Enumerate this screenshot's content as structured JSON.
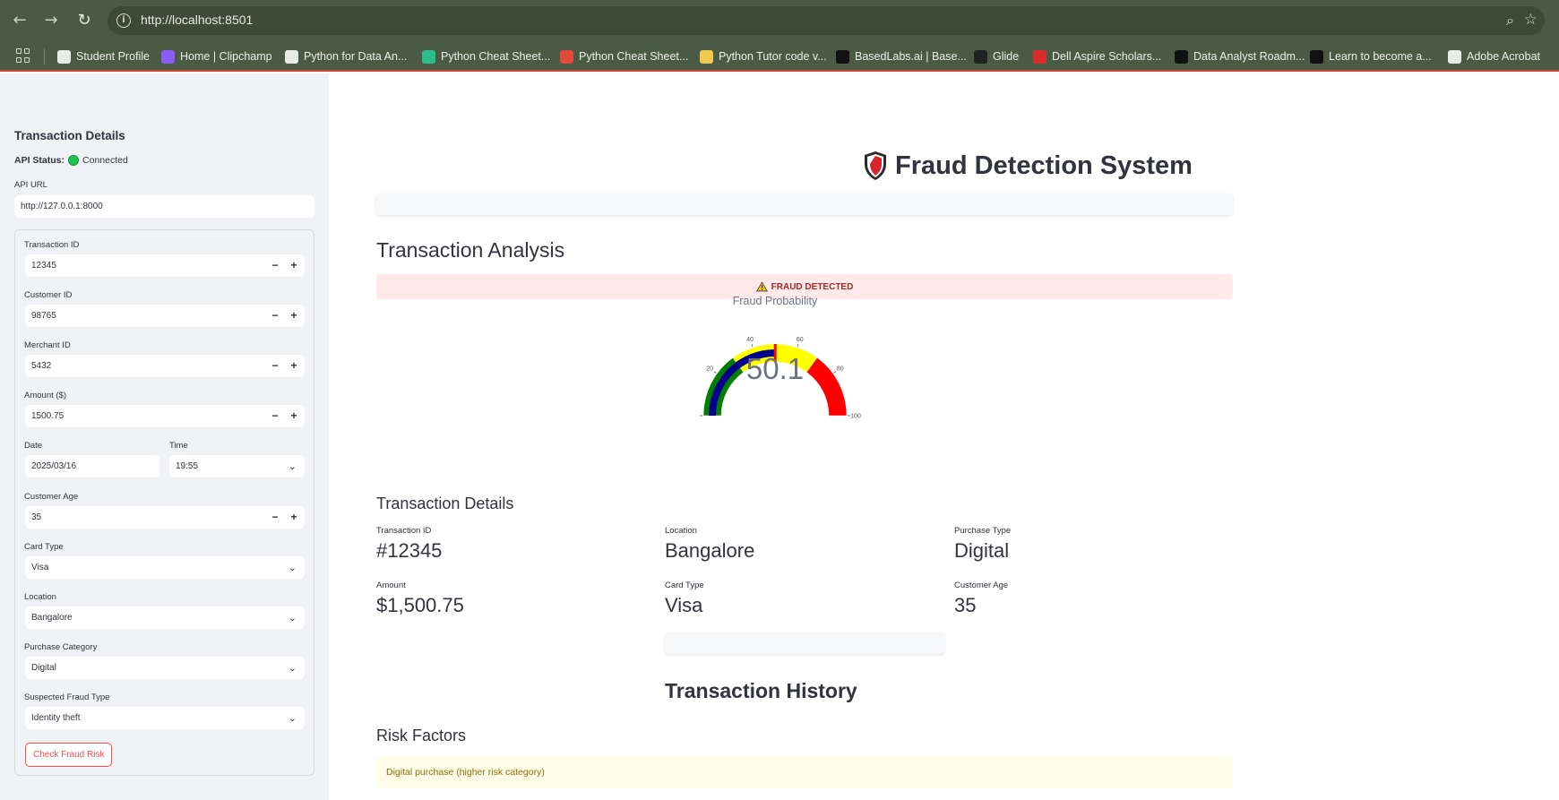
{
  "browser": {
    "url": "http://localhost:8501",
    "bookmarks": [
      {
        "label": "Student Profile",
        "color": "#e8ece5"
      },
      {
        "label": "Home | Clipchamp",
        "color": "#8a5cf5"
      },
      {
        "label": "Python for Data An...",
        "color": "#e8ece5"
      },
      {
        "label": "Python Cheat Sheet...",
        "color": "#2bbd8c"
      },
      {
        "label": "Python Cheat Sheet...",
        "color": "#e04a3a"
      },
      {
        "label": "Python Tutor code v...",
        "color": "#f2c94c"
      },
      {
        "label": "BasedLabs.ai | Base...",
        "color": "#111111"
      },
      {
        "label": "Glide",
        "color": "#222222"
      },
      {
        "label": "Dell Aspire Scholars...",
        "color": "#d92b2b"
      },
      {
        "label": "Data Analyst Roadm...",
        "color": "#111111"
      },
      {
        "label": "Learn to become a...",
        "color": "#111111"
      },
      {
        "label": "Adobe Acrobat",
        "color": "#e8ece5"
      }
    ]
  },
  "sidebar": {
    "title": "Transaction Details",
    "api_status_label": "API Status:",
    "api_status_value": "Connected",
    "api_url_label": "API URL",
    "api_url_value": "http://127.0.0.1:8000",
    "transaction_id_label": "Transaction ID",
    "transaction_id_value": "12345",
    "customer_id_label": "Customer ID",
    "customer_id_value": "98765",
    "merchant_id_label": "Merchant ID",
    "merchant_id_value": "5432",
    "amount_label": "Amount ($)",
    "amount_value": "1500.75",
    "date_label": "Date",
    "date_value": "2025/03/16",
    "time_label": "Time",
    "time_value": "19:55",
    "customer_age_label": "Customer Age",
    "customer_age_value": "35",
    "card_type_label": "Card Type",
    "card_type_value": "Visa",
    "location_label": "Location",
    "location_value": "Bangalore",
    "purchase_category_label": "Purchase Category",
    "purchase_category_value": "Digital",
    "fraud_type_label": "Suspected Fraud Type",
    "fraud_type_value": "Identity theft",
    "check_button": "Check Fraud Risk"
  },
  "main": {
    "title": "Fraud Detection System",
    "analysis_heading": "Transaction Analysis",
    "alert_text": "FRAUD DETECTED",
    "gauge": {
      "title": "Fraud Probability",
      "value": 50.1,
      "value_text": "50.1",
      "min": 0,
      "max": 100,
      "ticks": [
        "0",
        "20",
        "40",
        "60",
        "80",
        "100"
      ],
      "steps": [
        {
          "from": 0,
          "to": 30,
          "color": "#008000"
        },
        {
          "from": 30,
          "to": 70,
          "color": "#ffff00"
        },
        {
          "from": 70,
          "to": 100,
          "color": "#ff0000"
        }
      ],
      "bar_color": "#00008b",
      "threshold_color": "#ff0000"
    },
    "details_heading": "Transaction Details",
    "details": {
      "transaction_id_label": "Transaction ID",
      "transaction_id_value": "#12345",
      "location_label": "Location",
      "location_value": "Bangalore",
      "purchase_type_label": "Purchase Type",
      "purchase_type_value": "Digital",
      "amount_label": "Amount",
      "amount_value": "$1,500.75",
      "card_type_label": "Card Type",
      "card_type_value": "Visa",
      "customer_age_label": "Customer Age",
      "customer_age_value": "35"
    },
    "history_heading": "Transaction History",
    "risk_heading": "Risk Factors",
    "risk_items": [
      "Digital purchase (higher risk category)"
    ]
  }
}
